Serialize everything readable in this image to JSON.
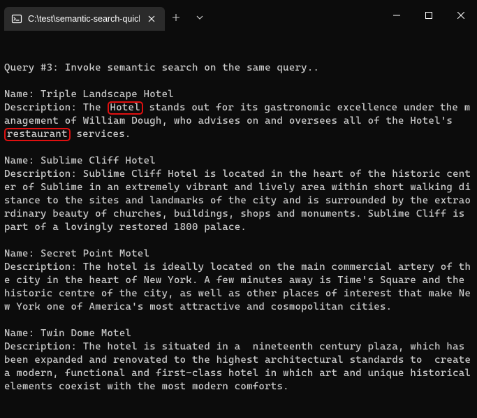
{
  "window": {
    "tab_title": "C:\\test\\semantic-search-quick"
  },
  "terminal": {
    "pre1": "\n\nQuery #3: Invoke semantic search on the same query..\n\nName: Triple Landscape Hotel\nDescription: The ",
    "hl1": "Hotel",
    "mid1": " stands out for its gastronomic excellence under the management of William Dough, who advises on and oversees all of the Hotel's ",
    "hl2": "restaurant",
    "post1": " services.\n\nName: Sublime Cliff Hotel\nDescription: Sublime Cliff Hotel is located in the heart of the historic center of Sublime in an extremely vibrant and lively area within short walking distance to the sites and landmarks of the city and is surrounded by the extraordinary beauty of churches, buildings, shops and monuments. Sublime Cliff is part of a lovingly restored 1800 palace.\n\nName: Secret Point Motel\nDescription: The hotel is ideally located on the main commercial artery of the city in the heart of New York. A few minutes away is Time's Square and the historic centre of the city, as well as other places of interest that make New York one of America's most attractive and cosmopolitan cities.\n\nName: Twin Dome Motel\nDescription: The hotel is situated in a  nineteenth century plaza, which has been expanded and renovated to the highest architectural standards to  create a modern, functional and first-class hotel in which art and unique historical elements coexist with the most modern comforts."
  }
}
